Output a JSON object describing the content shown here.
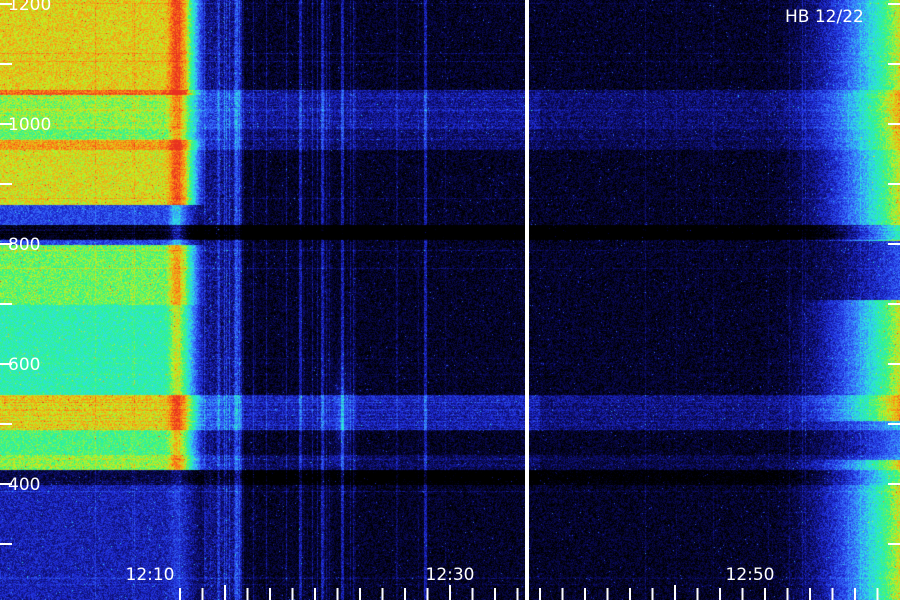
{
  "chart_data": {
    "type": "heatmap",
    "annotation": "HB 12/22",
    "y_ticks": [
      {
        "value": 1200,
        "label": "1200"
      },
      {
        "value": 1000,
        "label": "1000"
      },
      {
        "value": 800,
        "label": "800"
      },
      {
        "value": 600,
        "label": "600"
      },
      {
        "value": 400,
        "label": "400"
      }
    ],
    "y_minor_ticks": [
      1100,
      900,
      700,
      500,
      300
    ],
    "ylim": [
      250,
      1200
    ],
    "x_ticks": [
      {
        "value": "12:10",
        "label": "12:10"
      },
      {
        "value": "12:30",
        "label": "12:30"
      },
      {
        "value": "12:50",
        "label": "12:50"
      }
    ],
    "xlim": [
      "12:03",
      "12:63"
    ],
    "x_tick_minutes": [
      12.0,
      13.5,
      15,
      16.5,
      18,
      19.5,
      21,
      22.5,
      24,
      25.5,
      27,
      28.5,
      30,
      31.5,
      33,
      34.5,
      36,
      37.5,
      39,
      40.5,
      42,
      43.5,
      45,
      46.5,
      48,
      49.5,
      51,
      52.5,
      54,
      55.5,
      57,
      58.5
    ],
    "divider_time": "12:35",
    "colormap": [
      "#000000",
      "#0a0a5a",
      "#1e2ad8",
      "#3a78ff",
      "#2ee0e8",
      "#2cf58a",
      "#c8f01e",
      "#ff8c14",
      "#e83020"
    ]
  }
}
